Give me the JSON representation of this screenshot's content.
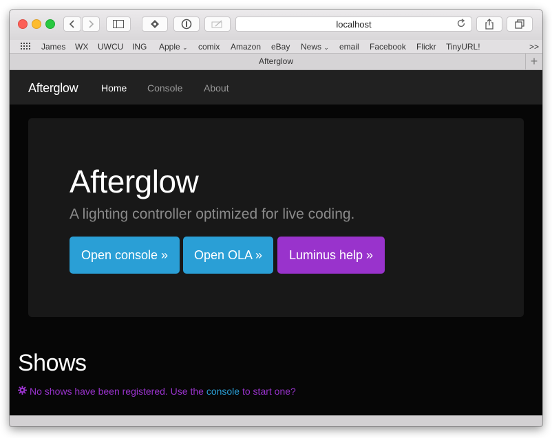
{
  "browser": {
    "url": "localhost",
    "tab_title": "Afterglow",
    "bookmarks": [
      "James",
      "WX",
      "UWCU",
      "ING",
      "Apple",
      "comix",
      "Amazon",
      "eBay",
      "News",
      "email",
      "Facebook",
      "Flickr",
      "TinyURL!"
    ],
    "overflow": ">>"
  },
  "nav": {
    "brand": "Afterglow",
    "links": [
      "Home",
      "Console",
      "About"
    ]
  },
  "hero": {
    "title": "Afterglow",
    "subtitle": "A lighting controller optimized for live coding.",
    "buttons": [
      "Open console »",
      "Open OLA »",
      "Luminus help »"
    ]
  },
  "shows": {
    "heading": "Shows",
    "message_before": "No shows have been registered. Use the",
    "message_link": "console",
    "message_after": "to start one?"
  },
  "colors": {
    "primary": "#2a9fd6",
    "purple": "#9933cc",
    "navbar": "#212121",
    "jumbotron": "#181818",
    "background": "#060606"
  },
  "icons": {
    "notice": "gear-icon"
  }
}
